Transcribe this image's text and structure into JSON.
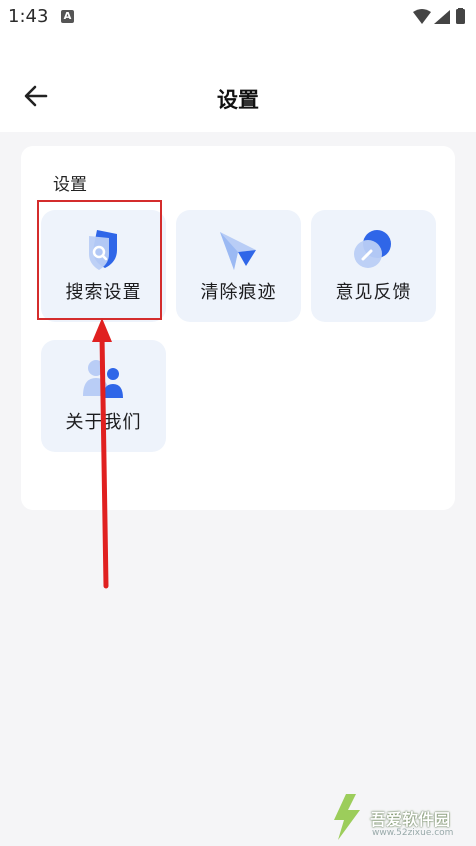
{
  "status_bar": {
    "time": "1:43",
    "notification_badge": "A"
  },
  "app_bar": {
    "title": "设置",
    "back_icon": "arrow-left-icon"
  },
  "settings_card": {
    "section_title": "设置",
    "items": [
      {
        "label": "搜索设置",
        "icon": "search-shield-icon"
      },
      {
        "label": "清除痕迹",
        "icon": "paper-plane-icon"
      },
      {
        "label": "意见反馈",
        "icon": "edit-bubble-icon"
      },
      {
        "label": "关于我们",
        "icon": "users-icon"
      }
    ]
  },
  "annotation": {
    "highlight_color": "#d42c2c",
    "arrow_color": "#e02020"
  },
  "watermark": {
    "text": "吾爱软件园",
    "url": "www.52zixue.com"
  },
  "colors": {
    "accent": "#3b6ef0",
    "tile_bg": "#eef3fb",
    "page_bg": "#f5f5f7"
  }
}
